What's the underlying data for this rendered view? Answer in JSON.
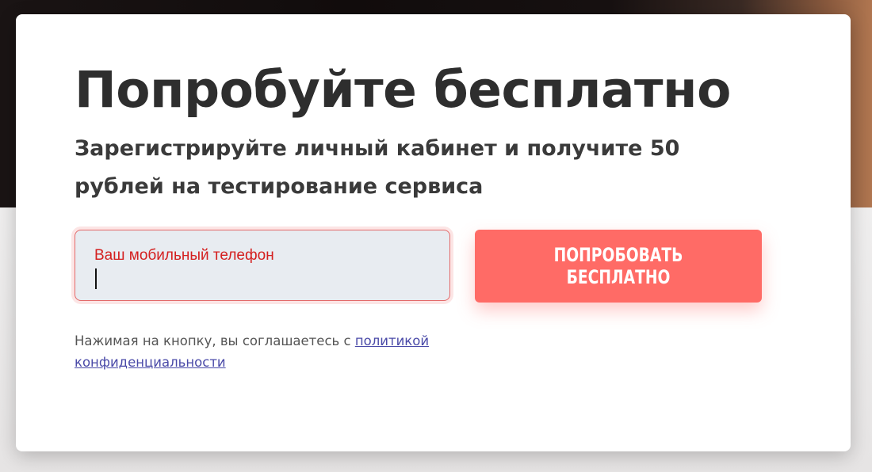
{
  "page": {
    "title": "Попробуйте бесплатно",
    "subtitle": "Зарегистрируйте личный кабинет и получите 50 рублей на тестирование сервиса"
  },
  "form": {
    "phone_label": "Ваш мобильный телефон",
    "phone_value": "",
    "submit_label": "ПОПРОБОВАТЬ БЕСПЛАТНО"
  },
  "consent": {
    "text": "Нажимая на кнопку, вы соглашаетесь с ",
    "link_label": "политикой конфиденциальности"
  },
  "colors": {
    "accent": "#ff6b66",
    "error": "#d42020",
    "link": "#4a4aa8"
  }
}
